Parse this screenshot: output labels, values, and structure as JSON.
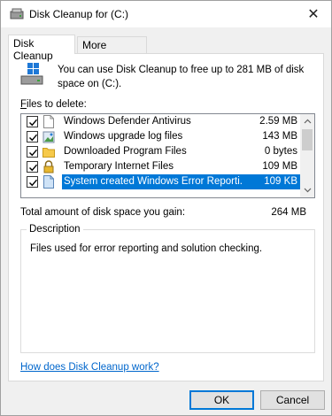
{
  "window": {
    "title": "Disk Cleanup for  (C:)",
    "close_glyph": "✕"
  },
  "tabs": [
    {
      "label": "Disk Cleanup",
      "active": true
    },
    {
      "label": "More Options",
      "active": false
    }
  ],
  "intro": {
    "text": "You can use Disk Cleanup to free up to 281 MB of disk space on  (C:)."
  },
  "files": {
    "label_prefix": "",
    "label_underlined": "F",
    "label_rest": "iles to delete:",
    "items": [
      {
        "name": "Windows Defender Antivirus",
        "size": "2.59 MB",
        "checked": true,
        "selected": false,
        "icon": "file-icon"
      },
      {
        "name": "Windows upgrade log files",
        "size": "143 MB",
        "checked": true,
        "selected": false,
        "icon": "image-file-icon"
      },
      {
        "name": "Downloaded Program Files",
        "size": "0 bytes",
        "checked": true,
        "selected": false,
        "icon": "folder-icon"
      },
      {
        "name": "Temporary Internet Files",
        "size": "109 MB",
        "checked": true,
        "selected": false,
        "icon": "lock-icon"
      },
      {
        "name": "System created Windows Error Reporti...",
        "size": "109 KB",
        "checked": true,
        "selected": true,
        "icon": "file-icon"
      }
    ]
  },
  "total": {
    "label": "Total amount of disk space you gain:",
    "value": "264 MB"
  },
  "description": {
    "legend": "Description",
    "text": "Files used for error reporting and solution checking."
  },
  "help_link": "How does Disk Cleanup work?",
  "buttons": {
    "ok": "OK",
    "cancel": "Cancel"
  }
}
